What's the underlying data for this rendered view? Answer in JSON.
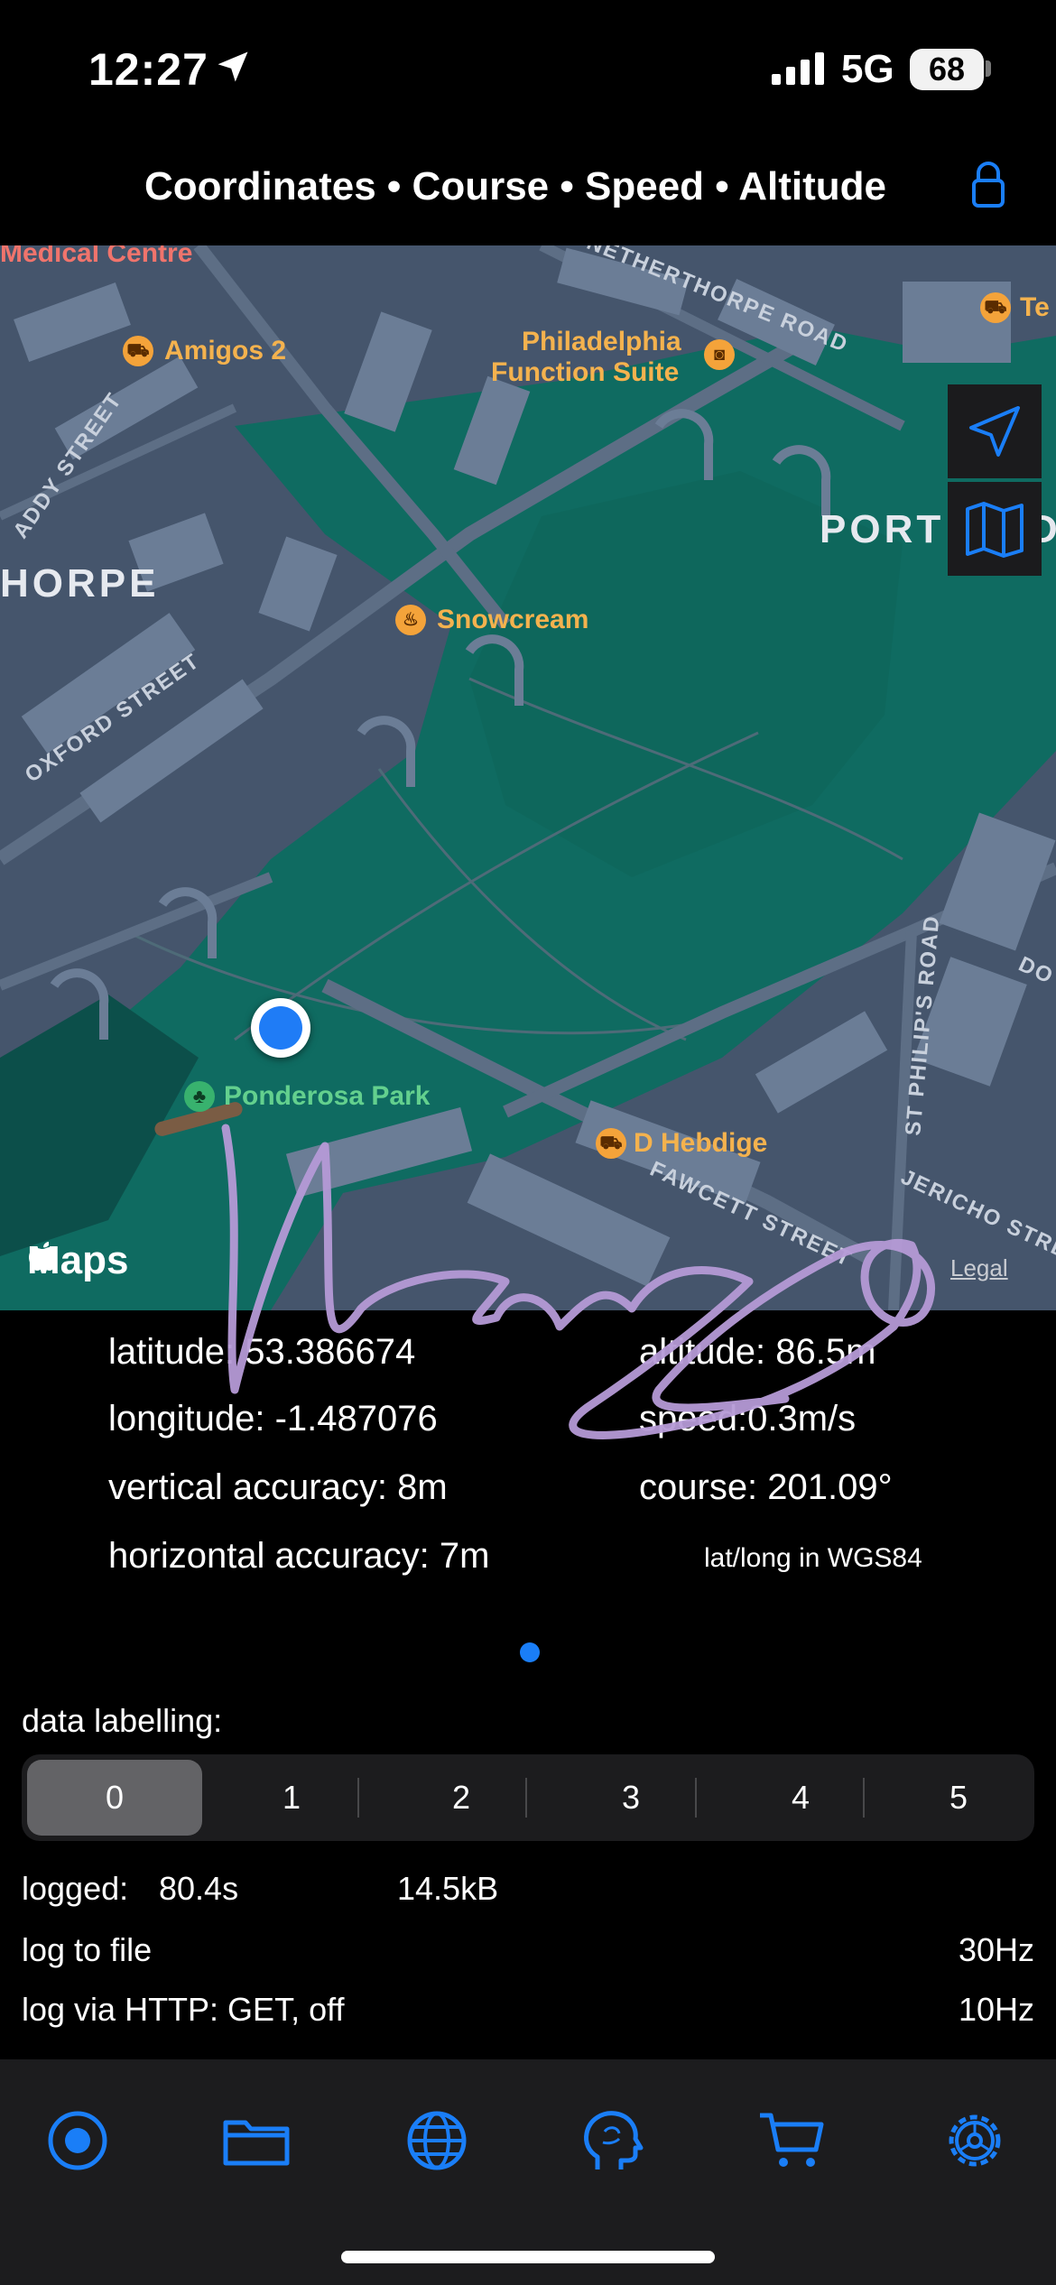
{
  "status_bar": {
    "time": "12:27",
    "network": "5G",
    "battery": "68"
  },
  "header": {
    "title": "Coordinates • Course • Speed • Altitude"
  },
  "map": {
    "labels": {
      "medical": "Medical Centre",
      "amigos": "Amigos 2",
      "philadelphia_1": "Philadelphia",
      "philadelphia_2": "Function Suite",
      "snowcream": "Snowcream",
      "ponderosa": "Ponderosa Park",
      "hebdige": "D Hebdige",
      "te": "Te",
      "netherthorpe_rd": "NETHERTHORPE ROAD",
      "addy_st": "ADDY STREET",
      "oxford_st": "OXFORD STREET",
      "fawcett_st": "FAWCETT STREET",
      "st_philips_rd": "ST PHILIP'S ROAD",
      "jericho_st": "JERICHO STRE",
      "do": "DO",
      "thorpe": "HORPE",
      "port": "PORT M",
      "port_end": "D"
    },
    "attribution": "Maps",
    "legal": "Legal"
  },
  "readings": {
    "latitude": "latitude: 53.386674",
    "longitude": "longitude: -1.487076",
    "vertical_accuracy": "vertical accuracy: 8m",
    "horizontal_accuracy": "horizontal accuracy: 7m",
    "altitude": "altitude: 86.5m",
    "speed": "speed:0.3m/s",
    "course": "course: 201.09°",
    "datum_note": "lat/long in WGS84"
  },
  "labelling": {
    "title": "data labelling:",
    "options": [
      "0",
      "1",
      "2",
      "3",
      "4",
      "5"
    ],
    "selected": "0"
  },
  "logging": {
    "logged_label": "logged:",
    "logged_time": "80.4s",
    "logged_size": "14.5kB",
    "file_label": "log to file",
    "file_rate": "30Hz",
    "http_label": "log via HTTP: GET, off",
    "http_rate": "10Hz"
  },
  "tabs": [
    "record-icon",
    "folder-icon",
    "globe-icon",
    "brain-icon",
    "cart-icon",
    "gear-icon"
  ],
  "colors": {
    "accent": "#1a7ef7",
    "park": "#0f6f63",
    "blocks": "#45556c",
    "signature": "#b59ad6"
  }
}
